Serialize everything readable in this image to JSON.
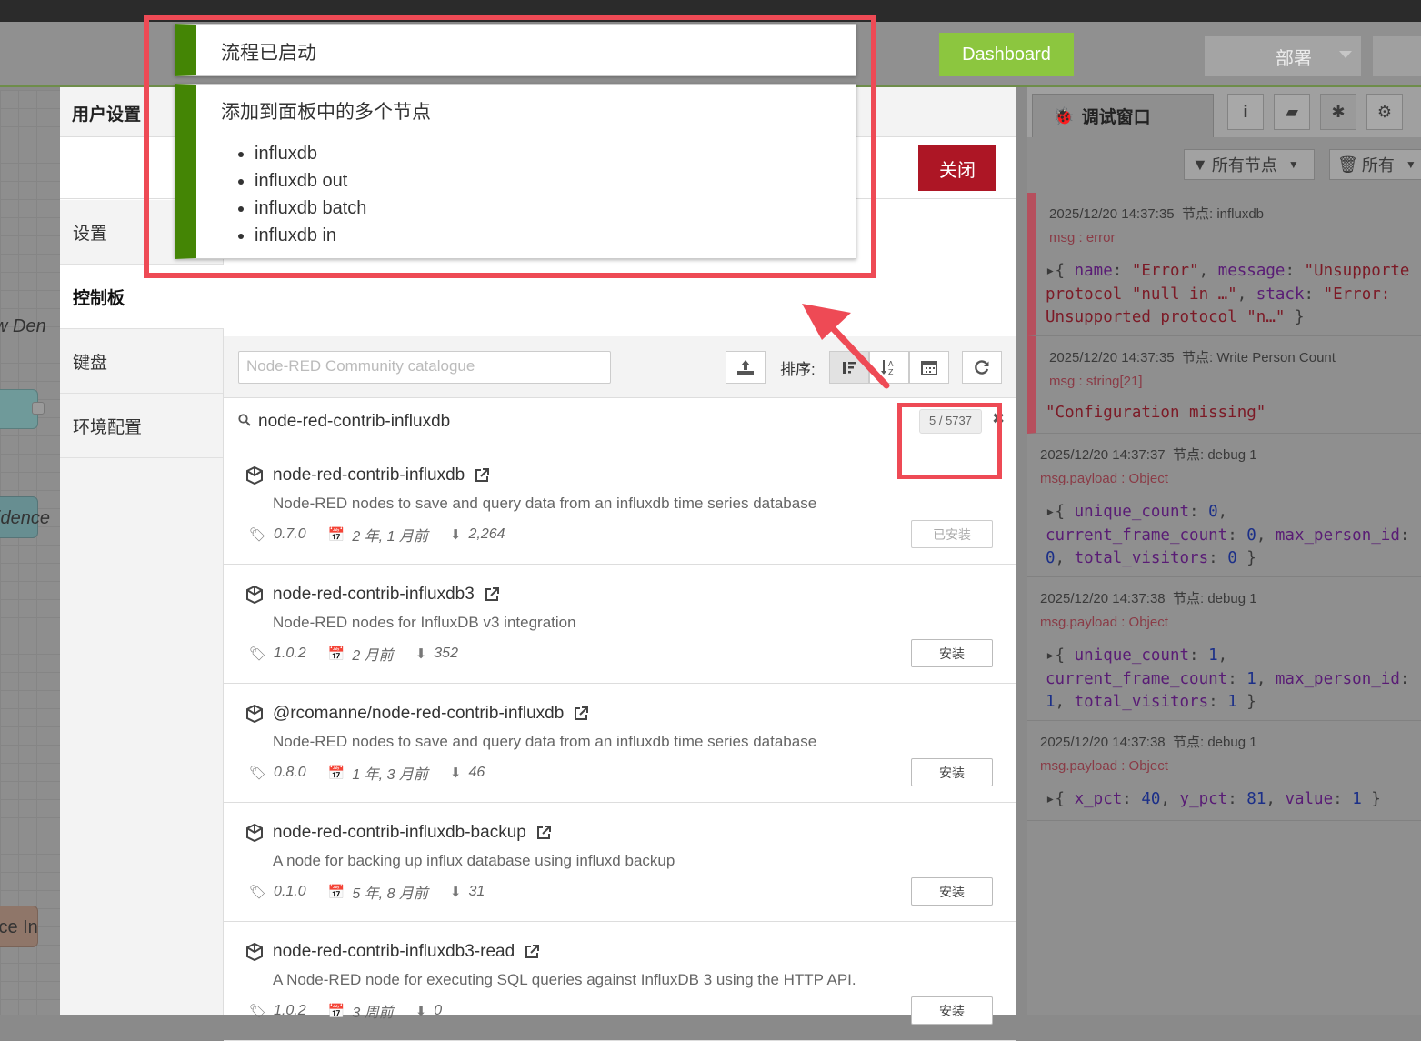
{
  "header": {
    "dashboard_label": "Dashboard",
    "deploy_label": "部署"
  },
  "canvas": {
    "node1_label": "w Den",
    "node2_label": "idence",
    "node3_label": "ice In"
  },
  "settings": {
    "title": "用户设置",
    "close_label": "关闭",
    "nav": [
      "设置",
      "控制板",
      "键盘",
      "环境配置"
    ]
  },
  "palette": {
    "catalog_placeholder": "Node-RED Community catalogue",
    "sort_label": "排序:",
    "search_value": "node-red-contrib-influxdb",
    "result_count": "5 / 5737",
    "packages": [
      {
        "name": "node-red-contrib-influxdb",
        "description": "Node-RED nodes to save and query data from an influxdb time series database",
        "version": "0.7.0",
        "updated": "2 年, 1 月前",
        "downloads": "2,264",
        "action": "已安装"
      },
      {
        "name": "node-red-contrib-influxdb3",
        "description": "Node-RED nodes for InfluxDB v3 integration",
        "version": "1.0.2",
        "updated": "2 月前",
        "downloads": "352",
        "action": "安装"
      },
      {
        "name": "@rcomanne/node-red-contrib-influxdb",
        "description": "Node-RED nodes to save and query data from an influxdb time series database",
        "version": "0.8.0",
        "updated": "1 年, 3 月前",
        "downloads": "46",
        "action": "安装"
      },
      {
        "name": "node-red-contrib-influxdb-backup",
        "description": "A node for backing up influx database using influxd backup",
        "version": "0.1.0",
        "updated": "5 年, 8 月前",
        "downloads": "31",
        "action": "安装"
      },
      {
        "name": "node-red-contrib-influxdb3-read",
        "description": "A Node-RED node for executing SQL queries against InfluxDB 3 using the HTTP API.",
        "version": "1.0.2",
        "updated": "3 周前",
        "downloads": "0",
        "action": "安装"
      }
    ]
  },
  "notifications": {
    "n1": "流程已启动",
    "n2_title": "添加到面板中的多个节点",
    "n2_items": [
      "influxdb",
      "influxdb out",
      "influxdb batch",
      "influxdb in"
    ]
  },
  "sidebar": {
    "tab_label": "调试窗口",
    "filter_nodes": "所有节点",
    "filter_clear": "所有",
    "messages": [
      {
        "time": "2025/12/20 14:37:35",
        "node": "节点: influxdb",
        "type": "msg : error"
      },
      {
        "time": "2025/12/20 14:37:35",
        "node": "节点: Write Person Count",
        "type": "msg : string[21]",
        "value": "\"Configuration missing\""
      },
      {
        "time": "2025/12/20 14:37:37",
        "node": "节点: debug 1",
        "type": "msg.payload : Object"
      },
      {
        "time": "2025/12/20 14:37:38",
        "node": "节点: debug 1",
        "type": "msg.payload : Object"
      },
      {
        "time": "2025/12/20 14:37:38",
        "node": "节点: debug 1",
        "type": "msg.payload : Object"
      }
    ]
  }
}
